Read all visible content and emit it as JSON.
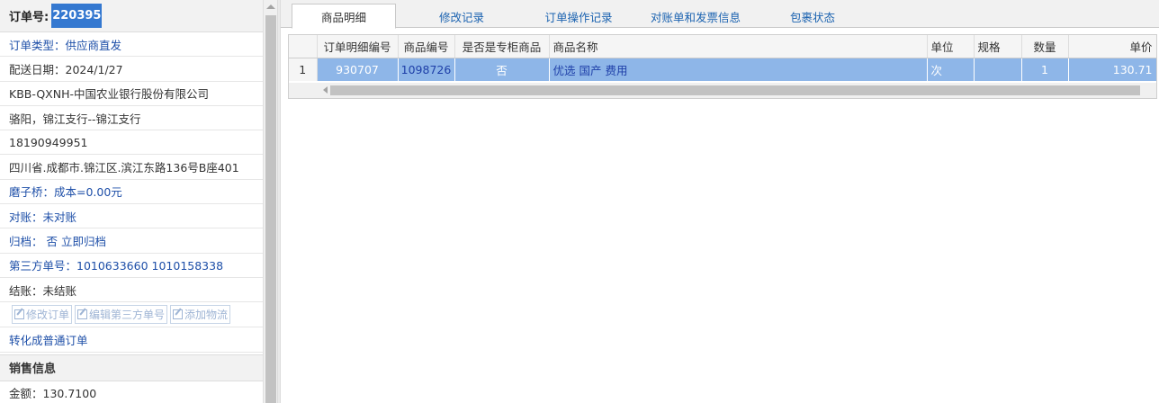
{
  "order": {
    "label": "订单号:",
    "number": "220395"
  },
  "info_rows": [
    "订单类型：供应商直发",
    "配送日期：2024/1/27",
    "KBB-QXNH-中国农业银行股份有限公司",
    "骆阳，锦江支行--锦江支行",
    "18190949951",
    "四川省.成都市.锦江区.滨江东路136号B座401",
    "磨子桥：成本=0.00元",
    "对账：未对账",
    "归档： 否 立即归档",
    "第三方单号：1010633660 1010158338",
    "结账：未结账"
  ],
  "action_buttons": [
    "修改订单",
    "编辑第三方单号",
    "添加物流"
  ],
  "convert_link": "转化成普通订单",
  "sales_section": {
    "title": "销售信息",
    "amount": "金额：130.7100"
  },
  "tabs": [
    "商品明细",
    "修改记录",
    "订单操作记录",
    "对账单和发票信息",
    "包裹状态"
  ],
  "active_tab": "商品明细",
  "table": {
    "columns": [
      "订单明细编号",
      "商品编号",
      "是否是专柜商品",
      "商品名称",
      "单位",
      "规格",
      "数量",
      "单价"
    ],
    "rows": [
      {
        "row_number": "1",
        "detail_id": "930707",
        "product_id": "1098726",
        "counter": "否",
        "name": "优选 国产 费用",
        "unit": "次",
        "spec": "",
        "qty": "1",
        "price": "130.71"
      }
    ]
  },
  "colors": {
    "accent": "#3478d0",
    "selected_row": "#8eb6e8",
    "link_blue": "#1e4fa8"
  }
}
